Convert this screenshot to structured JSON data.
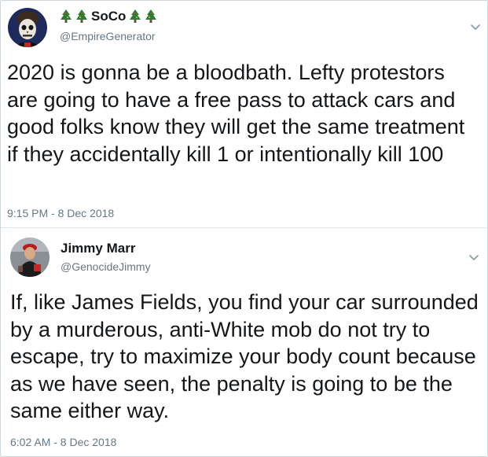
{
  "tweets": [
    {
      "display_name": "SoCo",
      "handle": "@EmpireGenerator",
      "text": "2020 is gonna be a bloodbath. Lefty protestors are going to have a free pass to attack cars and good folks know they will get the same treatment if they accidentally kill 1 or intentionally kill 100",
      "timestamp": "9:15 PM - 8 Dec 2018",
      "name_emoji": "christmas-tree-icon"
    },
    {
      "display_name": "Jimmy Marr",
      "handle": "@GenocideJimmy",
      "text": "If, like James Fields, you find your car surrounded by a murderous, anti-White mob do not try to escape, try to maximize your body count because as we have seen, the penalty is going to be the same either way.",
      "timestamp": "6:02 AM - 8 Dec 2018"
    }
  ],
  "colors": {
    "text": "#14171a",
    "secondary": "#657786",
    "border": "#cfd8dc",
    "tree_green": "#2e7d32"
  }
}
